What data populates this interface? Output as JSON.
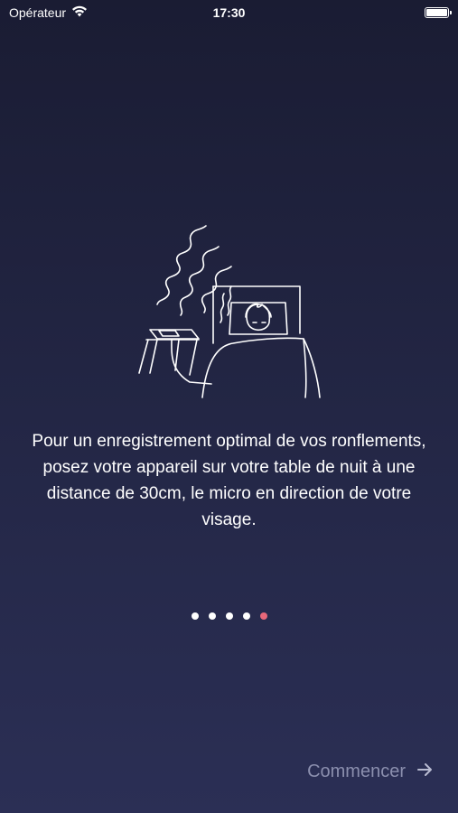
{
  "status_bar": {
    "carrier": "Opérateur",
    "time": "17:30"
  },
  "illustration": {
    "icon": "person-sleeping-with-phone-on-nightstand-icon"
  },
  "message": "Pour un enregistrement optimal de vos ronflements, posez votre appareil sur votre table de nuit à une distance de 30cm, le micro en direction de votre visage.",
  "pagination": {
    "total": 5,
    "active_index": 4,
    "active_color": "#e8687a",
    "inactive_color": "#ffffff"
  },
  "start_button": {
    "label": "Commencer",
    "icon": "arrow-right-icon"
  }
}
